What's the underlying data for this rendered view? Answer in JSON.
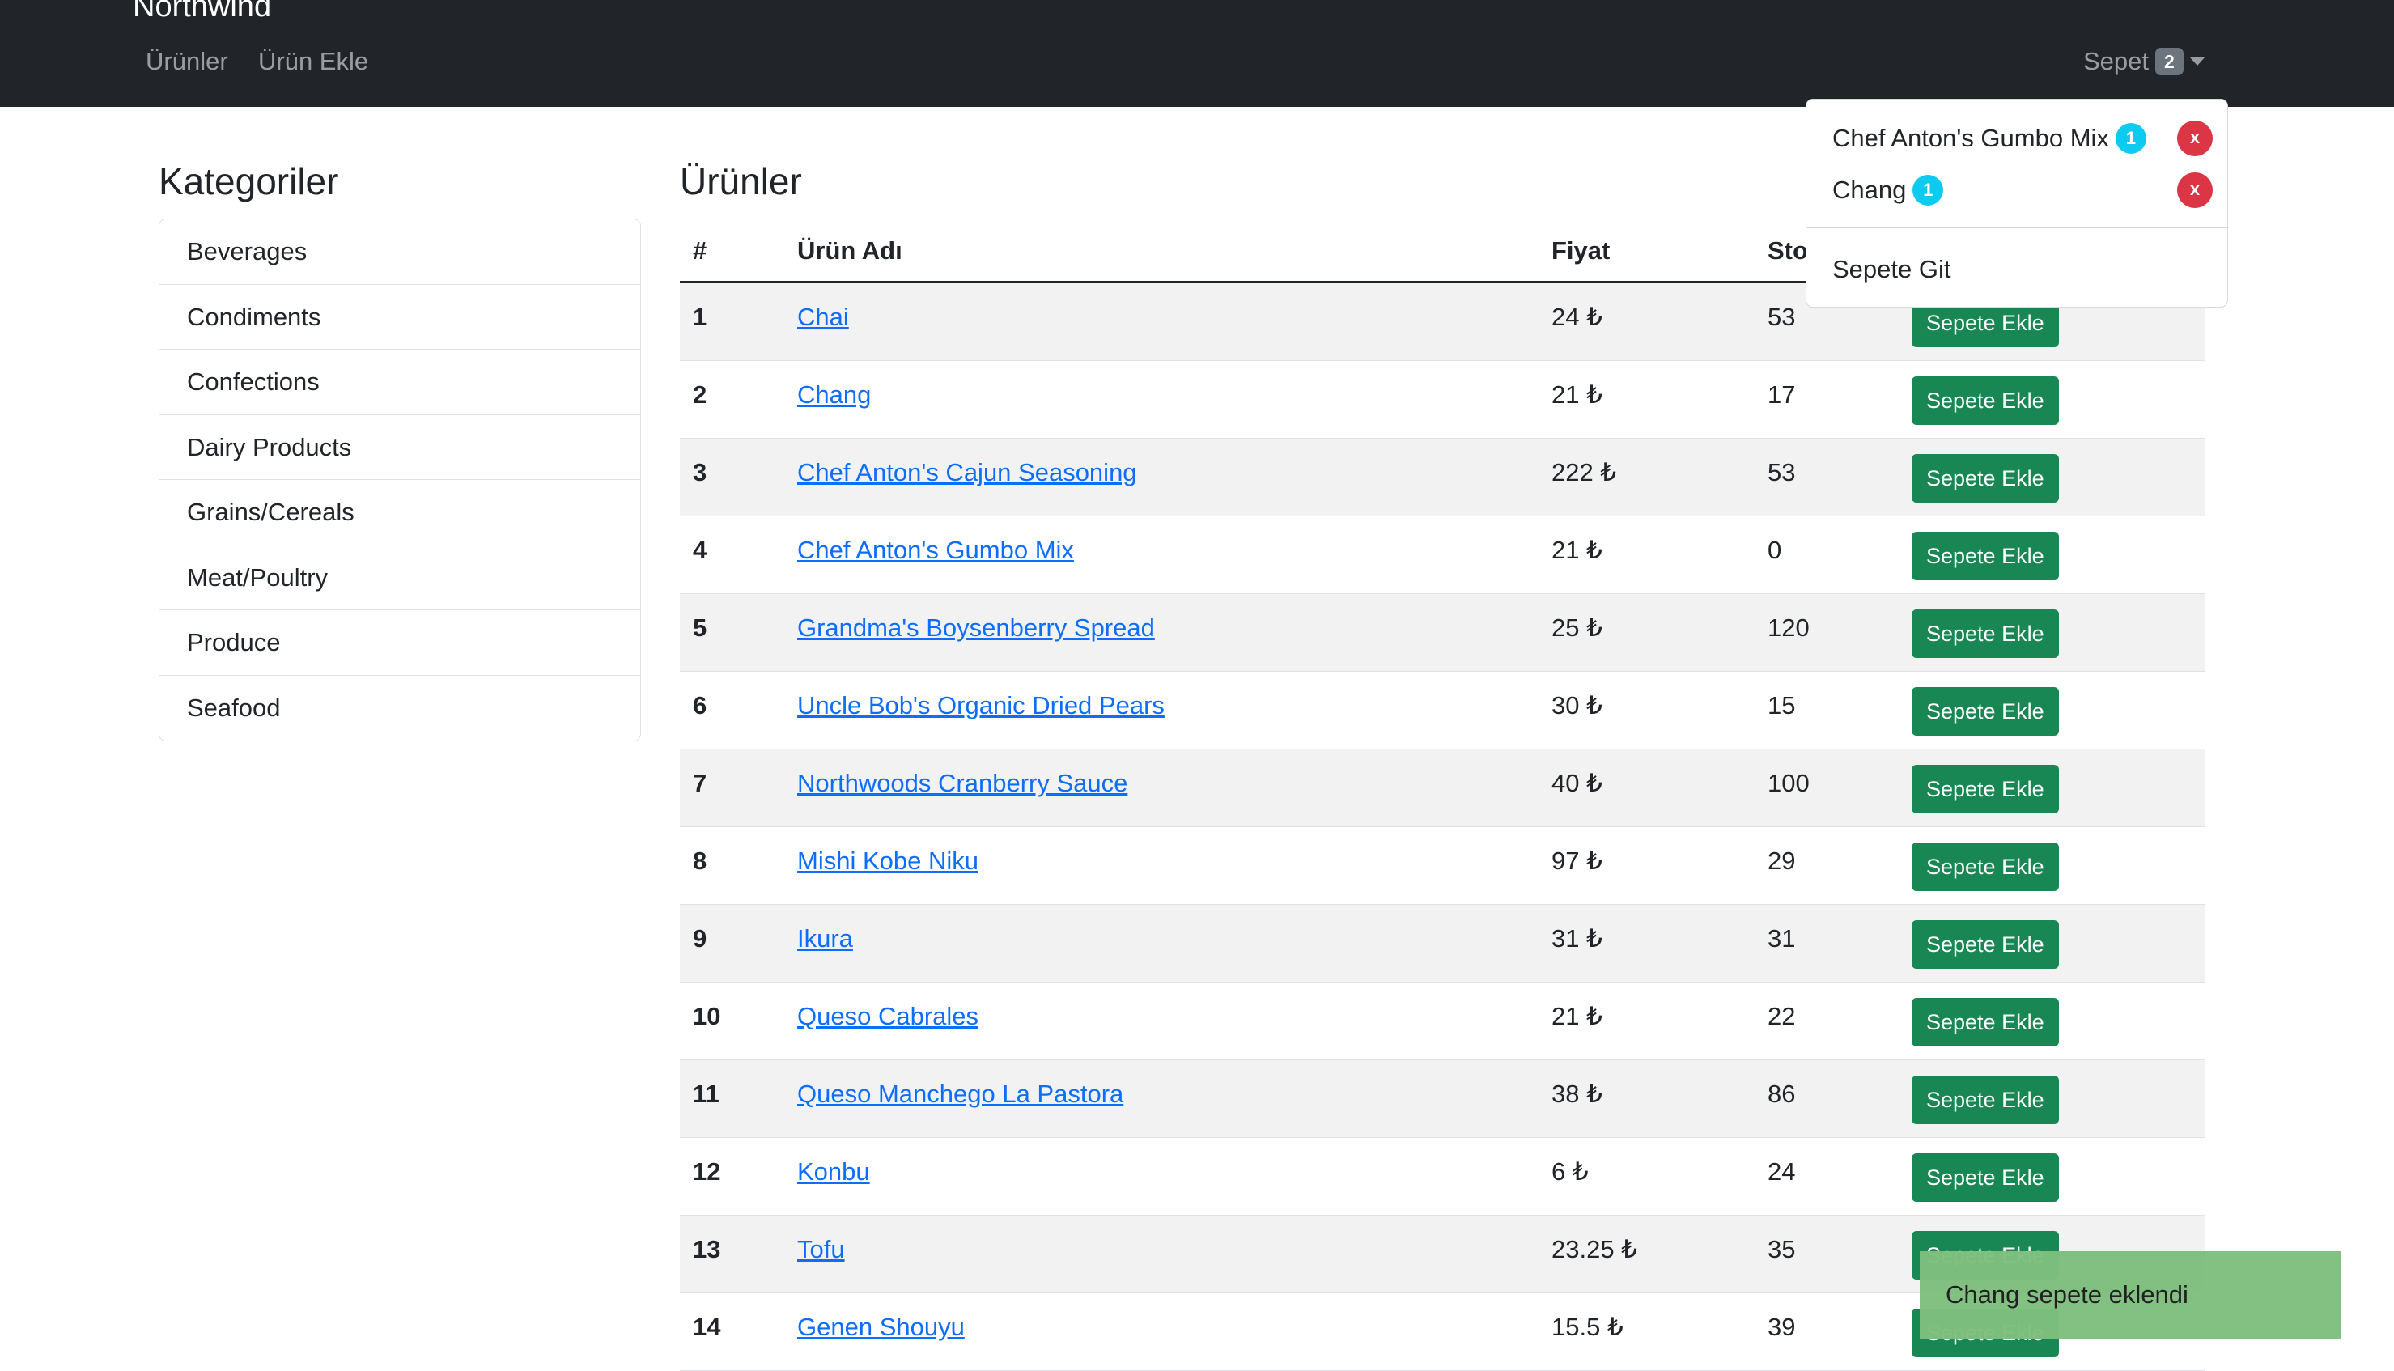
{
  "navbar": {
    "brand": "Northwind",
    "links": [
      "Ürünler",
      "Ürün Ekle"
    ],
    "cart": {
      "label": "Sepet",
      "count": "2"
    }
  },
  "sidebar": {
    "title": "Kategoriler",
    "items": [
      "Beverages",
      "Condiments",
      "Confections",
      "Dairy Products",
      "Grains/Cereals",
      "Meat/Poultry",
      "Produce",
      "Seafood"
    ]
  },
  "main": {
    "title": "Ürünler",
    "columns": [
      "#",
      "Ürün Adı",
      "Fiyat",
      "Sto"
    ],
    "add_label": "Sepete Ekle",
    "rows": [
      {
        "id": "1",
        "name": "Chai",
        "price": "24 ₺",
        "stock": "53"
      },
      {
        "id": "2",
        "name": "Chang",
        "price": "21 ₺",
        "stock": "17"
      },
      {
        "id": "3",
        "name": "Chef Anton's Cajun Seasoning",
        "price": "222 ₺",
        "stock": "53"
      },
      {
        "id": "4",
        "name": "Chef Anton's Gumbo Mix",
        "price": "21 ₺",
        "stock": "0"
      },
      {
        "id": "5",
        "name": "Grandma's Boysenberry Spread",
        "price": "25 ₺",
        "stock": "120"
      },
      {
        "id": "6",
        "name": "Uncle Bob's Organic Dried Pears",
        "price": "30 ₺",
        "stock": "15"
      },
      {
        "id": "7",
        "name": "Northwoods Cranberry Sauce",
        "price": "40 ₺",
        "stock": "100"
      },
      {
        "id": "8",
        "name": "Mishi Kobe Niku",
        "price": "97 ₺",
        "stock": "29"
      },
      {
        "id": "9",
        "name": "Ikura",
        "price": "31 ₺",
        "stock": "31"
      },
      {
        "id": "10",
        "name": "Queso Cabrales",
        "price": "21 ₺",
        "stock": "22"
      },
      {
        "id": "11",
        "name": "Queso Manchego La Pastora",
        "price": "38 ₺",
        "stock": "86"
      },
      {
        "id": "12",
        "name": "Konbu",
        "price": "6 ₺",
        "stock": "24"
      },
      {
        "id": "13",
        "name": "Tofu",
        "price": "23.25 ₺",
        "stock": "35"
      },
      {
        "id": "14",
        "name": "Genen Shouyu",
        "price": "15.5 ₺",
        "stock": "39"
      }
    ]
  },
  "cart_dropdown": {
    "items": [
      {
        "name": "Chef Anton's Gumbo Mix",
        "qty": "1",
        "remove": "x"
      },
      {
        "name": "Chang",
        "qty": "1",
        "remove": "x"
      }
    ],
    "go_to_cart": "Sepete Git"
  },
  "toast": {
    "message": "Chang sepete eklendi"
  },
  "colors": {
    "navbar": "#212529",
    "success": "#198754",
    "link": "#0d6efd",
    "info_badge": "#0dcaf0",
    "danger": "#dc3545",
    "toast": "#7fbf7f"
  }
}
